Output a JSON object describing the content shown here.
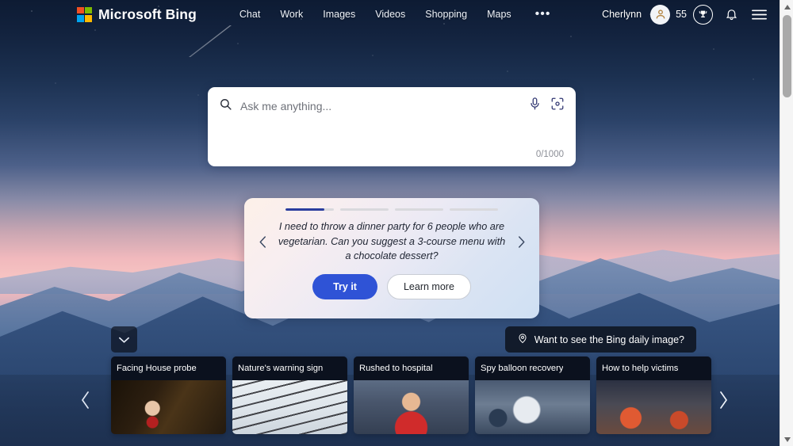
{
  "header": {
    "brand": "Microsoft Bing",
    "logo_icon": "microsoft-logo-icon",
    "nav": [
      {
        "label": "Chat"
      },
      {
        "label": "Work"
      },
      {
        "label": "Images"
      },
      {
        "label": "Videos"
      },
      {
        "label": "Shopping"
      },
      {
        "label": "Maps"
      }
    ],
    "more_label": "•••",
    "user_name": "Cherlynn",
    "avatar_icon": "user-avatar-icon",
    "rewards_count": "55",
    "rewards_icon": "trophy-badge-icon",
    "notifications_icon": "bell-icon",
    "menu_icon": "hamburger-menu-icon"
  },
  "search": {
    "placeholder": "Ask me anything...",
    "value": "",
    "search_icon": "search-icon",
    "mic_icon": "microphone-icon",
    "visual_icon": "visual-search-camera-icon",
    "counter": "0/1000"
  },
  "suggestion": {
    "prompt": "I need to throw a dinner party for 6 people who are vegetarian. Can you suggest a 3-course menu with a chocolate dessert?",
    "try_label": "Try it",
    "learn_label": "Learn more",
    "prev_icon": "chevron-left-icon",
    "next_icon": "chevron-right-icon",
    "progress": [
      {
        "fill_percent": 80,
        "active": true
      },
      {
        "fill_percent": 0,
        "active": false
      },
      {
        "fill_percent": 0,
        "active": false
      },
      {
        "fill_percent": 0,
        "active": false
      }
    ],
    "accent_color": "#2a3d9e",
    "primary_button_color": "#2f53d6"
  },
  "daily_image": {
    "label": "Want to see the Bing daily image?",
    "icon": "location-pin-icon"
  },
  "news": {
    "collapse_icon": "chevron-down-icon",
    "prev_icon": "chevron-left-icon",
    "next_icon": "chevron-right-icon",
    "cards": [
      {
        "title": "Facing House probe",
        "image_class": "img-congress"
      },
      {
        "title": "Nature's warning sign",
        "image_class": "img-wires"
      },
      {
        "title": "Rushed to hospital",
        "image_class": "img-stadium"
      },
      {
        "title": "Spy balloon recovery",
        "image_class": "img-balloon"
      },
      {
        "title": "How to help victims",
        "image_class": "img-crowd"
      }
    ]
  },
  "scrollbar": {
    "up_icon": "scroll-up-arrow-icon",
    "down_icon": "scroll-down-arrow-icon",
    "thumb": "scrollbar-thumb"
  }
}
